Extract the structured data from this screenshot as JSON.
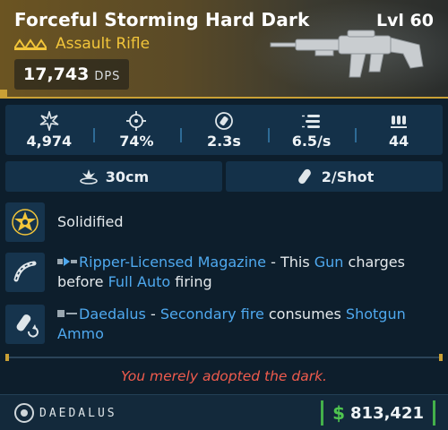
{
  "item": {
    "name": "Forceful Storming Hard Dark",
    "level": "Lvl 60",
    "rarity_icon": "legendary-chevrons-icon",
    "type": "Assault Rifle",
    "dps_value": "17,743",
    "dps_label": "DPS"
  },
  "stats": [
    {
      "icon": "damage-burst-icon",
      "value": "4,974"
    },
    {
      "icon": "accuracy-crosshair-icon",
      "value": "74%"
    },
    {
      "icon": "reload-icon",
      "value": "2.3s"
    },
    {
      "icon": "fire-rate-icon",
      "value": "6.5/s"
    },
    {
      "icon": "magazine-ammo-icon",
      "value": "44"
    }
  ],
  "stats_secondary": [
    {
      "icon": "splash-radius-icon",
      "value": "30cm"
    },
    {
      "icon": "ammo-cost-icon",
      "value": "2/Shot"
    }
  ],
  "perks": {
    "element": {
      "icon": "solidified-star-icon",
      "text": "Solidified"
    },
    "part1": {
      "icon": "magazine-part-icon",
      "badge_icon": "ripper-logo-icon",
      "name": "Ripper-Licensed Magazine",
      "t1": " - This ",
      "k1": "Gun",
      "t2": " charges before ",
      "k2": "Full Auto",
      "t3": " firing"
    },
    "part2": {
      "icon": "shotgun-ammo-part-icon",
      "badge_icon": "daedalus-logo-icon",
      "name": "Daedalus",
      "t1": " - ",
      "k1": "Secondary fire",
      "t2": " consumes ",
      "k2": "Shotgun Ammo"
    }
  },
  "flavor_text": "You merely adopted the dark.",
  "footer": {
    "manufacturer": "DAEDALUS",
    "currency_icon": "dollar-icon",
    "currency_symbol": "$",
    "price": "813,421"
  },
  "colors": {
    "accent_gold": "#f2c53a",
    "keyword_blue": "#4fa9ef",
    "flavor_red": "#ef5b4d",
    "money_green": "#4fc54f"
  }
}
